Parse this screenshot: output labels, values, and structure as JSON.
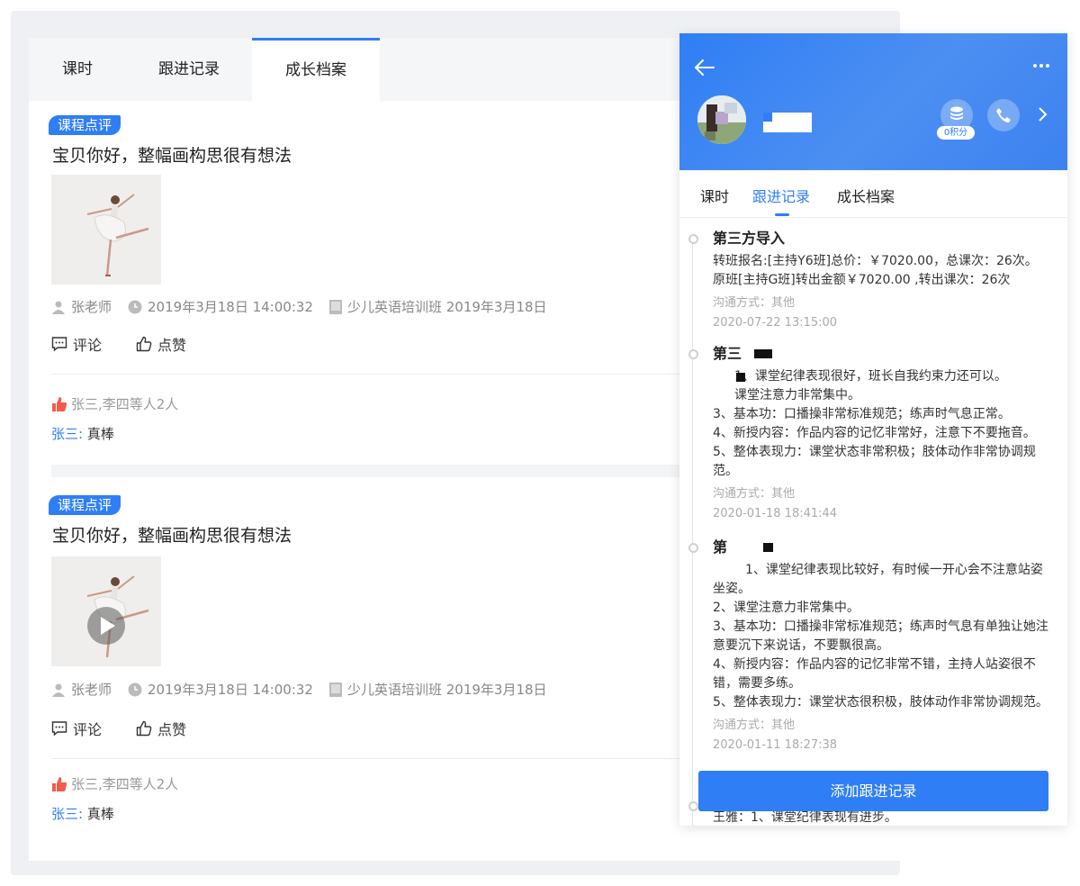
{
  "main": {
    "tabs": [
      {
        "label": "课时"
      },
      {
        "label": "跟进记录"
      },
      {
        "label": "成长档案",
        "active": true
      }
    ],
    "posts": [
      {
        "badge": "课程点评",
        "title": "宝贝你好，整幅画构思很有想法",
        "has_video": false,
        "author": "张老师",
        "datetime": "2019年3月18日  14:00:32",
        "class_info": "少儿英语培训班 2019年3月18日",
        "comment_label": "评论",
        "like_label": "点赞",
        "likes_text": "张三,李四等人2人",
        "comment_name": "张三:",
        "comment_text": "真棒"
      },
      {
        "badge": "课程点评",
        "title": "宝贝你好，整幅画构思很有想法",
        "has_video": true,
        "author": "张老师",
        "datetime": "2019年3月18日  14:00:32",
        "class_info": "少儿英语培训班 2019年3月18日",
        "comment_label": "评论",
        "like_label": "点赞",
        "likes_text": "张三,李四等人2人",
        "comment_name": "张三:",
        "comment_text": "真棒"
      }
    ]
  },
  "phone": {
    "points_label": "0积分",
    "tabs": [
      {
        "label": "课时"
      },
      {
        "label": "跟进记录",
        "active": true
      },
      {
        "label": "成长档案"
      }
    ],
    "entries": [
      {
        "title": "第三方导入",
        "lines": [
          "转班报名:[主持Y6班]总价：￥7020.00，总课次：26次。",
          "原班[主持G班]转出金额￥7020.00 ,转出课次：26次"
        ],
        "channel": "沟通方式：其他",
        "time": "2020-07-22 13:15:00"
      },
      {
        "title": "第三",
        "lines": [
          "1、课堂纪律表现很好，班长自我约束力还可以。",
          "课堂注意力非常集中。",
          "3、基本功：口播操非常标准规范；练声时气息正常。",
          "4、新授内容：作品内容的记忆非常好，注意下不要拖音。",
          "5、整体表现力：课堂状态非常积极；肢体动作非常协调规范。"
        ],
        "channel": "沟通方式：其他",
        "time": "2020-01-18 18:41:44"
      },
      {
        "title": "第",
        "lines": [
          "1、课堂纪律表现比较好，有时候一开心会不注意站姿坐姿。",
          "2、课堂注意力非常集中。",
          "3、基本功：口播操非常标准规范；练声时气息有单独让她注意要沉下来说话，不要飘很高。",
          "4、新授内容：作品内容的记忆非常不错，主持人站姿很不错，需要多练。",
          "5、整体表现力：课堂状态很积极，肢体动作非常协调规范。"
        ],
        "channel": "沟通方式：其他",
        "time": "2020-01-11 18:27:38"
      },
      {
        "title": "",
        "lines": [
          "王雅：1、课堂纪律表现有进步。"
        ],
        "channel": "",
        "time": ""
      }
    ],
    "add_button": "添加跟进记录"
  },
  "colors": {
    "accent": "#2f7ef5",
    "like_red": "#f35b4a"
  }
}
